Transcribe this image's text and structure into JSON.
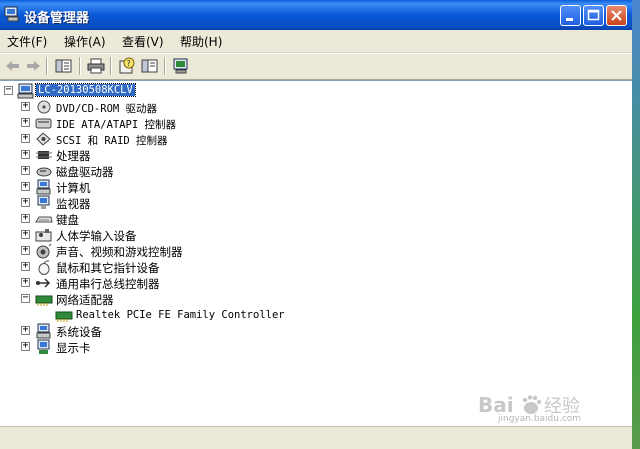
{
  "window": {
    "title": "设备管理器"
  },
  "menu": [
    {
      "label": "文件(F)"
    },
    {
      "label": "操作(A)"
    },
    {
      "label": "查看(V)"
    },
    {
      "label": "帮助(H)"
    }
  ],
  "toolbar": {
    "back": "back-arrow-icon",
    "forward": "forward-arrow-icon",
    "show_hide_tree": "show-hide-tree-icon",
    "print": "printer-icon",
    "properties": "properties-help-icon",
    "panel": "panel-icon",
    "scan": "scan-hardware-icon"
  },
  "tree": {
    "root": {
      "label": "LC-20130508KCLV",
      "expander": "−"
    },
    "items": [
      {
        "label": "DVD/CD-ROM 驱动器",
        "expander": "+",
        "icon": "dvd-drive-icon"
      },
      {
        "label": "IDE ATA/ATAPI 控制器",
        "expander": "+",
        "icon": "ide-controller-icon"
      },
      {
        "label": "SCSI 和 RAID 控制器",
        "expander": "+",
        "icon": "scsi-controller-icon"
      },
      {
        "label": "处理器",
        "expander": "+",
        "icon": "processor-icon"
      },
      {
        "label": "磁盘驱动器",
        "expander": "+",
        "icon": "disk-drive-icon"
      },
      {
        "label": "计算机",
        "expander": "+",
        "icon": "computer-icon"
      },
      {
        "label": "监视器",
        "expander": "+",
        "icon": "monitor-icon"
      },
      {
        "label": "键盘",
        "expander": "+",
        "icon": "keyboard-icon"
      },
      {
        "label": "人体学输入设备",
        "expander": "+",
        "icon": "hid-icon"
      },
      {
        "label": "声音、视频和游戏控制器",
        "expander": "+",
        "icon": "sound-icon"
      },
      {
        "label": "鼠标和其它指针设备",
        "expander": "+",
        "icon": "mouse-icon"
      },
      {
        "label": "通用串行总线控制器",
        "expander": "+",
        "icon": "usb-icon"
      },
      {
        "label": "网络适配器",
        "expander": "−",
        "icon": "network-adapter-icon"
      },
      {
        "label": "Realtek PCIe FE Family Controller",
        "child": true,
        "icon": "network-card-icon"
      },
      {
        "label": "系统设备",
        "expander": "+",
        "icon": "system-device-icon"
      },
      {
        "label": "显示卡",
        "expander": "+",
        "icon": "display-adapter-icon"
      }
    ]
  },
  "watermark": {
    "brand_latin": "Bai",
    "brand_cn": "经验",
    "url": "jingyan.baidu.com"
  },
  "colors": {
    "selection": "#316ac5",
    "titlebar": "#0a58d6",
    "close": "#c8441c"
  }
}
